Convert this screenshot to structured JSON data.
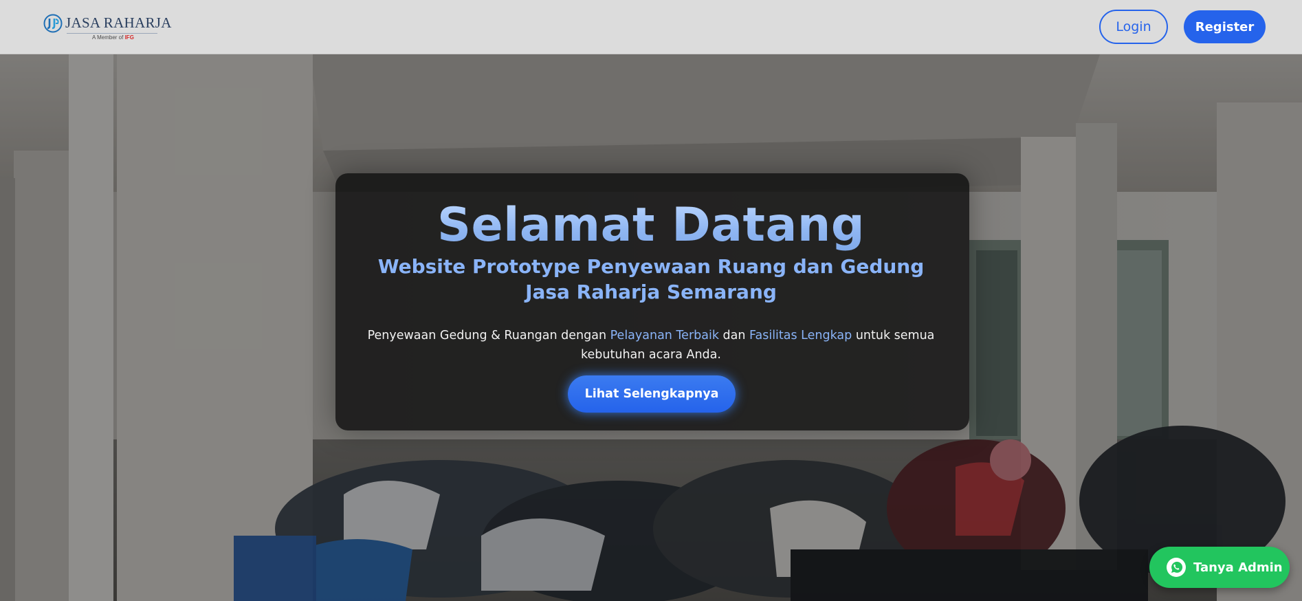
{
  "navbar": {
    "logo_text": "JASA RAHARJA",
    "logo_sub_prefix": "A Member of ",
    "logo_sub_brand": "IFG",
    "login_label": "Login",
    "register_label": "Register"
  },
  "hero": {
    "title": "Selamat Datang",
    "subtitle_line1": "Website Prototype Penyewaan Ruang dan Gedung",
    "subtitle_line2": "Jasa Raharja Semarang",
    "desc_part1": "Penyewaan Gedung & Ruangan dengan ",
    "desc_highlight1": "Pelayanan Terbaik",
    "desc_part2": " dan ",
    "desc_highlight2": "Fasilitas Lengkap",
    "desc_part3": " untuk semua",
    "desc_line2": "kebutuhan acara Anda.",
    "cta_label": "Lihat Selengkapnya"
  },
  "whatsapp": {
    "label": "Tanya Admin"
  },
  "colors": {
    "primary": "#2563eb",
    "accent_light": "#8ab4f8",
    "navbar_bg": "#dcdcdc",
    "whatsapp_green": "#22c55e"
  },
  "icons": {
    "logo": "jasa-raharja-logo-icon",
    "whatsapp": "whatsapp-icon"
  }
}
